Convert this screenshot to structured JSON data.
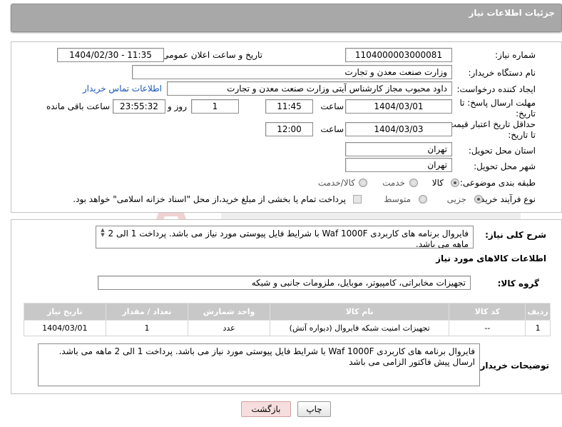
{
  "header": {
    "title": "جزئیات اطلاعات نیاز"
  },
  "fields": {
    "need_number": {
      "label": "شماره نیاز:",
      "value": "1104000003000081"
    },
    "announce_datetime": {
      "label": "تاریخ و ساعت اعلان عمومی:",
      "value": "1404/02/30 - 11:35"
    },
    "buyer_org": {
      "label": "نام دستگاه خریدار:",
      "value": "وزارت صنعت معدن و تجارت"
    },
    "requester": {
      "label": "ایجاد کننده درخواست:",
      "value": "داود محبوب مجاز کارشناس آیتی وزارت صنعت معدن و تجارت",
      "contact_link": "اطلاعات تماس خریدار"
    },
    "deadline": {
      "label_line1": "مهلت ارسال پاسخ: تا",
      "label_line2": "تاریخ:",
      "date": "1404/03/01",
      "time_label": "ساعت",
      "time": "11:45",
      "days": "1",
      "days_label": "روز و",
      "remaining": "23:55:32",
      "remaining_label": "ساعت باقی مانده"
    },
    "price_validity": {
      "label_line1": "حداقل تاریخ اعتبار قیمت:",
      "label_line2": "تا تاریخ:",
      "date": "1404/03/03",
      "time_label": "ساعت",
      "time": "12:00"
    },
    "delivery_province": {
      "label": "استان محل تحویل:",
      "value": "تهران"
    },
    "delivery_city": {
      "label": "شهر محل تحویل:",
      "value": "تهران"
    },
    "category": {
      "label": "طبقه بندی موضوعی:",
      "options": [
        "کالا",
        "خدمت",
        "کالا/خدمت"
      ],
      "selected": "کالا"
    },
    "purchase_process": {
      "label": "نوع فرآیند خرید :",
      "options": [
        "جزیی",
        "متوسط"
      ],
      "selected": "جزیی",
      "treasury_note": "پرداخت تمام یا بخشی از مبلغ خرید،از محل \"اسناد خزانه اسلامی\" خواهد بود."
    }
  },
  "description": {
    "label": "شرح کلی نیاز:",
    "text": "فایروال برنامه های کاربردی Waf 1000F با شرایط فایل پیوستی مورد نیاز می باشد. پرداخت 1 الی 2 ماهه می باشد."
  },
  "goods": {
    "section_title": "اطلاعات کالاهای مورد نیاز",
    "group_label": "گروه کالا:",
    "group_value": "تجهیزات مخابراتی، کامپیوتر، موبایل، ملزومات جانبی و شبکه",
    "columns": [
      "ردیف",
      "کد کالا",
      "نام کالا",
      "واحد شمارش",
      "تعداد / مقدار",
      "تاریخ نیاز"
    ],
    "rows": [
      [
        "1",
        "--",
        "تجهیزات امنیت شبکه فایروال (دیواره آتش)",
        "عدد",
        "1",
        "1404/03/01"
      ]
    ]
  },
  "buyer_notes": {
    "label": "توضیحات خریدار:",
    "line1": "فایروال برنامه های کاربردی Waf 1000F با شرایط فایل پیوستی مورد نیاز می باشد. پرداخت 1 الی 2 ماهه می باشد.",
    "line2": "ارسال پیش فاکتور الزامی می باشد"
  },
  "buttons": {
    "print": "چاپ",
    "back": "بازگشت"
  },
  "colors": {
    "header_bg": "#a8a8a8",
    "link": "#1a56b8",
    "back_button_bg": "#f7dede",
    "table_header": "#c8c8c8"
  }
}
